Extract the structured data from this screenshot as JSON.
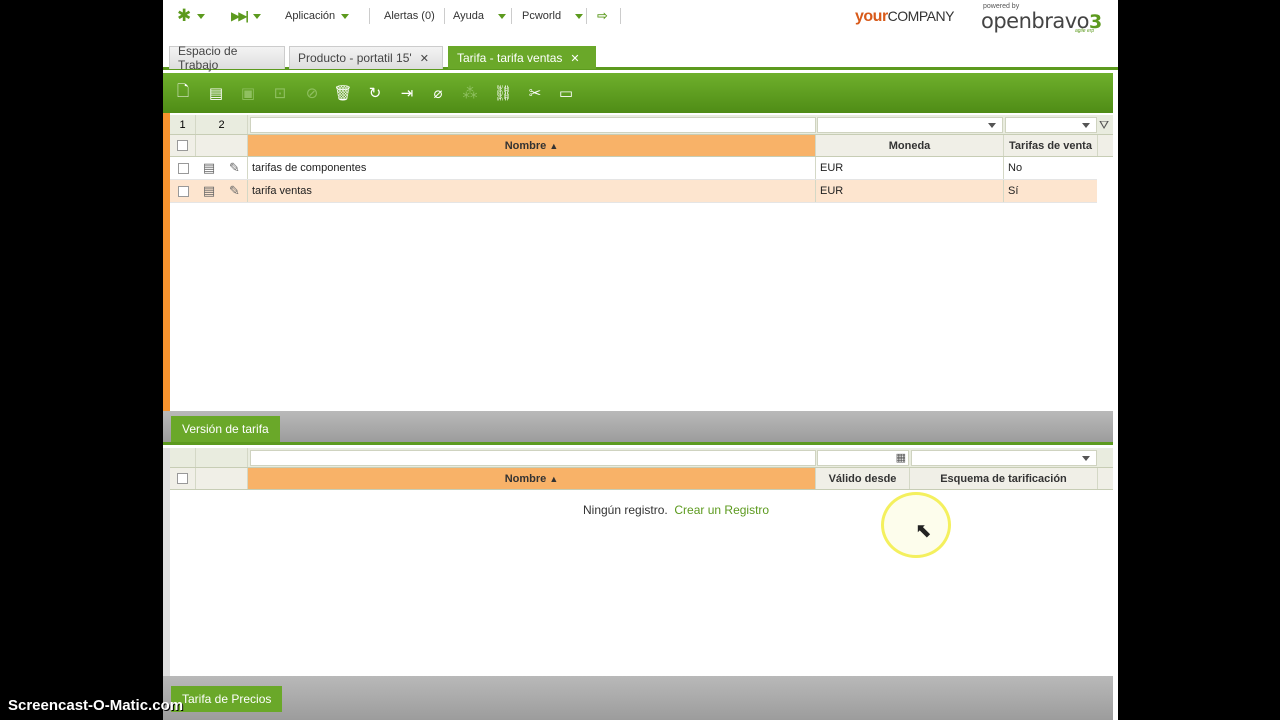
{
  "topnav": {
    "aplicacion": "Aplicación",
    "alertas": "Alertas (0)",
    "ayuda": "Ayuda",
    "org": "Pcworld"
  },
  "brand": {
    "company_a": "your",
    "company_b": "COMPANY",
    "powered": "powered by",
    "ob_a": "open",
    "ob_b": "bravo",
    "ob_ver": "3",
    "agile": "agile erp"
  },
  "tabs": [
    {
      "label": "Espacio de Trabajo"
    },
    {
      "label": "Producto - portatil 15'"
    },
    {
      "label": "Tarifa - tarifa ventas"
    }
  ],
  "grid1": {
    "levels": [
      "1",
      "2"
    ],
    "columns": [
      "Nombre",
      "Moneda",
      "Tarifas de venta"
    ],
    "sort_indicator": "▲",
    "rows": [
      {
        "nombre": "tarifas de componentes",
        "moneda": "EUR",
        "venta": "No"
      },
      {
        "nombre": "tarifa ventas",
        "moneda": "EUR",
        "venta": "Sí"
      }
    ]
  },
  "section1": {
    "label": "Versión de tarifa"
  },
  "grid2": {
    "columns": [
      "Nombre",
      "Válido desde",
      "Esquema de tarificación"
    ],
    "empty_text": "Ningún registro.",
    "create_link": "Crear un Registro"
  },
  "section2": {
    "label": "Tarifa de Precios"
  },
  "watermark": "Screencast-O-Matic.com",
  "colors": {
    "accent": "#5c9a1e",
    "orange": "#f7932e",
    "selected_row": "#fde5cf"
  }
}
